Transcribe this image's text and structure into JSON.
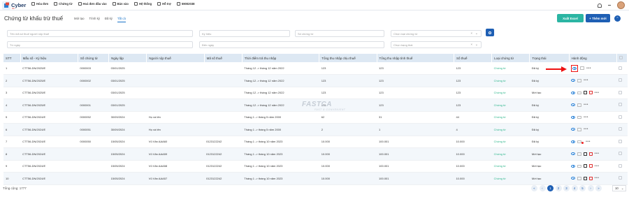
{
  "app": {
    "logo": "Cyber",
    "logo_sub": "bill"
  },
  "topnav": [
    {
      "label": "Hóa đơn"
    },
    {
      "label": "Chứng từ"
    },
    {
      "label": "Hoá đơn đầu vào"
    },
    {
      "label": "Bán vào"
    },
    {
      "label": "Hệ thống"
    },
    {
      "label": "Hỗ trợ"
    },
    {
      "label": "59002038"
    }
  ],
  "page": {
    "title": "Chứng từ khấu trừ thuế",
    "tabs": [
      "Mới tạo",
      "Trình ký",
      "Đã ký",
      "Tất cả"
    ],
    "active_tab": "Tất cả",
    "btn_excel": "Xuất Excel",
    "btn_add": "+ Thêm mới"
  },
  "filters": {
    "search_ph": "Tên mã số thuế người nộp thuế",
    "ky_hieu_ph": "Ký hiệu",
    "so_ct_ph": "Số chứng từ",
    "loai_ct_ph": "Chọn loại chứng từ",
    "tu_ngay_ph": "Từ ngày",
    "den_ngay_ph": "Đến ngày",
    "trang_thai_ph": "Chọn trạng thái"
  },
  "columns": [
    "STT",
    "Mẫu số - Ký hiệu",
    "Số chứng từ",
    "Ngày lập",
    "Người nộp thuế",
    "Mã số thuế",
    "Thời điểm trả thu nhập",
    "Tổng thu nhập chịu thuế",
    "Tổng thu nhập tính thuế",
    "Số thuế",
    "Loại chứng từ",
    "Trạng thái",
    "Hành động",
    ""
  ],
  "rows": [
    [
      "1",
      "CTT56-DN/2025/E",
      "0000003",
      "03/01/2025",
      "",
      "",
      "Tháng 12 -> tháng 12 năm 2022",
      "123",
      "123",
      "123",
      "Chứng từ",
      "Đã ký"
    ],
    [
      "2",
      "CTT56-DN/2025/E",
      "0000002",
      "03/01/2025",
      "",
      "",
      "Tháng 12 -> tháng 12 năm 2022",
      "123",
      "123",
      "123",
      "Chứng từ",
      "Đã ký"
    ],
    [
      "3",
      "CTT56-DN/2025/E",
      "",
      "03/01/2025",
      "",
      "",
      "Tháng 12 -> tháng 12 năm 2022",
      "123",
      "123",
      "123",
      "Chứng từ",
      "Mới tạo"
    ],
    [
      "4",
      "CTT56-DN/2025/E",
      "0000001",
      "03/01/2025",
      "",
      "",
      "Tháng 12 -> tháng 12 năm 2022",
      "123",
      "123",
      "123",
      "Chứng từ",
      "Đã ký"
    ],
    [
      "5",
      "CTT56-DN/2024/E",
      "0000052",
      "30/09/2024",
      "Họ và tên",
      "",
      "Tháng 1 -> tháng 5 năm 2000",
      "62",
      "31",
      "44",
      "Chứng từ",
      "Đã ký"
    ],
    [
      "6",
      "CTT56-DN/2024/E",
      "0000051",
      "30/09/2024",
      "Họ và tên",
      "",
      "Tháng 1 -> tháng 5 năm 2000",
      "2",
      "1",
      "4",
      "Chứng từ",
      "Đã ký"
    ],
    [
      "7",
      "CTT56-DN/2024/E",
      "0000050",
      "15/05/2024",
      "Vũ Văn AAA60",
      "0123122242",
      "Tháng 1 -> tháng 10 năm 2023",
      "10.000",
      "100.001",
      "10.000",
      "Chứng từ",
      "Đã ký"
    ],
    [
      "8",
      "CTT56-DN/2024/E",
      "",
      "15/05/2024",
      "Vũ Văn AAA59",
      "0123122242",
      "Tháng 1 -> tháng 10 năm 2023",
      "10.000",
      "100.001",
      "10.000",
      "Chứng từ",
      "Mới tạo"
    ],
    [
      "9",
      "CTT56-DN/2024/E",
      "",
      "15/05/2024",
      "Vũ Văn AAA58",
      "0123122242",
      "Tháng 1 -> tháng 10 năm 2023",
      "10.000",
      "100.001",
      "10.000",
      "Chứng từ",
      "Mới tạo"
    ],
    [
      "10",
      "CTT56-DN/2024/E",
      "",
      "15/05/2024",
      "Vũ Văn AAA57",
      "0123122242",
      "Tháng 1 -> tháng 10 năm 2023",
      "10.000",
      "100.001",
      "10.000",
      "Chứng từ",
      "Mới tạo"
    ]
  ],
  "watermark": {
    "brand": "FASTCA",
    "tagline": "FAST & CONVENIENT"
  },
  "footer": {
    "total": "Tổng cộng: 1777",
    "pages": [
      "«",
      "‹",
      "1",
      "2",
      "3",
      "4",
      "5",
      "›",
      "»"
    ],
    "current_page": "1",
    "page_size": "10"
  },
  "colors": {
    "accent": "#1e5fb4",
    "excel": "#2bb5a3",
    "highlight": "#e11111"
  }
}
